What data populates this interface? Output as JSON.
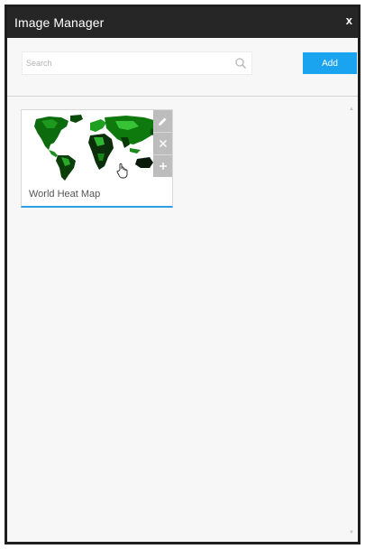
{
  "window": {
    "title": "Image Manager",
    "close_label": "x"
  },
  "search": {
    "placeholder": "Search",
    "value": ""
  },
  "toolbar": {
    "add_label": "Add",
    "accent_color": "#1aa3ef"
  },
  "images": [
    {
      "title": "World Heat Map",
      "thumbnail": "world-map-green"
    }
  ],
  "icons": {
    "edit": "pencil-icon",
    "remove": "x-icon",
    "add": "plus-icon",
    "search": "search-icon",
    "cursor": "hand-pointer-icon"
  }
}
